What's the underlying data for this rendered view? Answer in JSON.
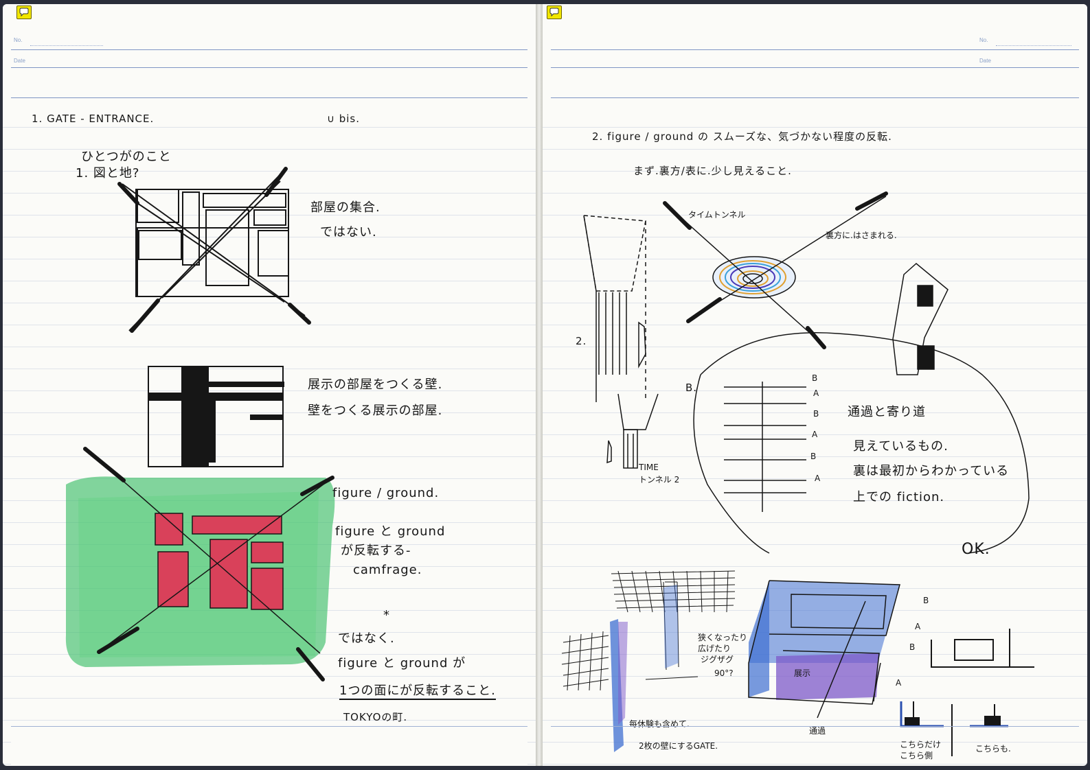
{
  "left_page": {
    "no_label": "No.",
    "date_label": "Date",
    "heading": "1. GATE - ENTRANCE.",
    "heading_note": "∪ bis.",
    "intro_line1": "ひとつがのこと",
    "intro_line2": "1. 図と地?",
    "note_rooms_1": "部屋の集合.",
    "note_rooms_2": "ではない.",
    "note_walls_1": "展示の部屋をつくる壁.",
    "note_walls_2": "壁をつくる展示の部屋.",
    "note_fg_title": "figure / ground.",
    "note_fg_1": "figure と ground",
    "note_fg_2": "が反転する-",
    "note_fg_3": "camfrage.",
    "asterisk": "*",
    "note_bottom_1": "ではなく.",
    "note_bottom_2": "figure と ground が",
    "note_bottom_3": "1つの面にが反転すること.",
    "note_bottom_4": "TOKYOの町."
  },
  "right_page": {
    "no_label": "No.",
    "date_label": "Date",
    "heading": "2. figure / ground の スムーズな、気づかない程度の反転.",
    "subheading": "まず.裏方/表に.少し見えること.",
    "time_tunnel": "タイムトンネル",
    "note_inside": "裏方に.はさまれる.",
    "label_2": "2.",
    "label_time": "TIME",
    "label_tunnel": "トンネル 2",
    "label_b_main": "B.",
    "section_labels": [
      "B",
      "A",
      "B",
      "A",
      "B",
      "A"
    ],
    "note_pass_title": "通過と寄り道",
    "note_pass_1": "見えているもの.",
    "note_pass_2": "裏は最初からわかっている",
    "note_pass_3": "上での fiction.",
    "ok": "OK.",
    "note_narrow_1": "狭くなったり",
    "note_narrow_2": "広げたり",
    "note_narrow_3": "ジグザグ",
    "note_angle": "90°?",
    "note_gate_1": "每休験も含めて.",
    "note_gate_2": "2枚の壁にするGATE.",
    "label_a_b": [
      "B",
      "A",
      "B",
      "A"
    ],
    "label_pass": "通過",
    "label_room": "展示",
    "label_this_only": "こちらだけ",
    "label_this_side": "こちら側",
    "label_also": "こちらも."
  },
  "colors": {
    "ink": "#161616",
    "green_wash": "#3fbf6a",
    "red_block": "#d9415a",
    "blue_wash": "#3f6fd1",
    "purple_wash": "#7e59c9",
    "header_rule": "#7e95c4",
    "comment_icon": "#f1e600"
  }
}
